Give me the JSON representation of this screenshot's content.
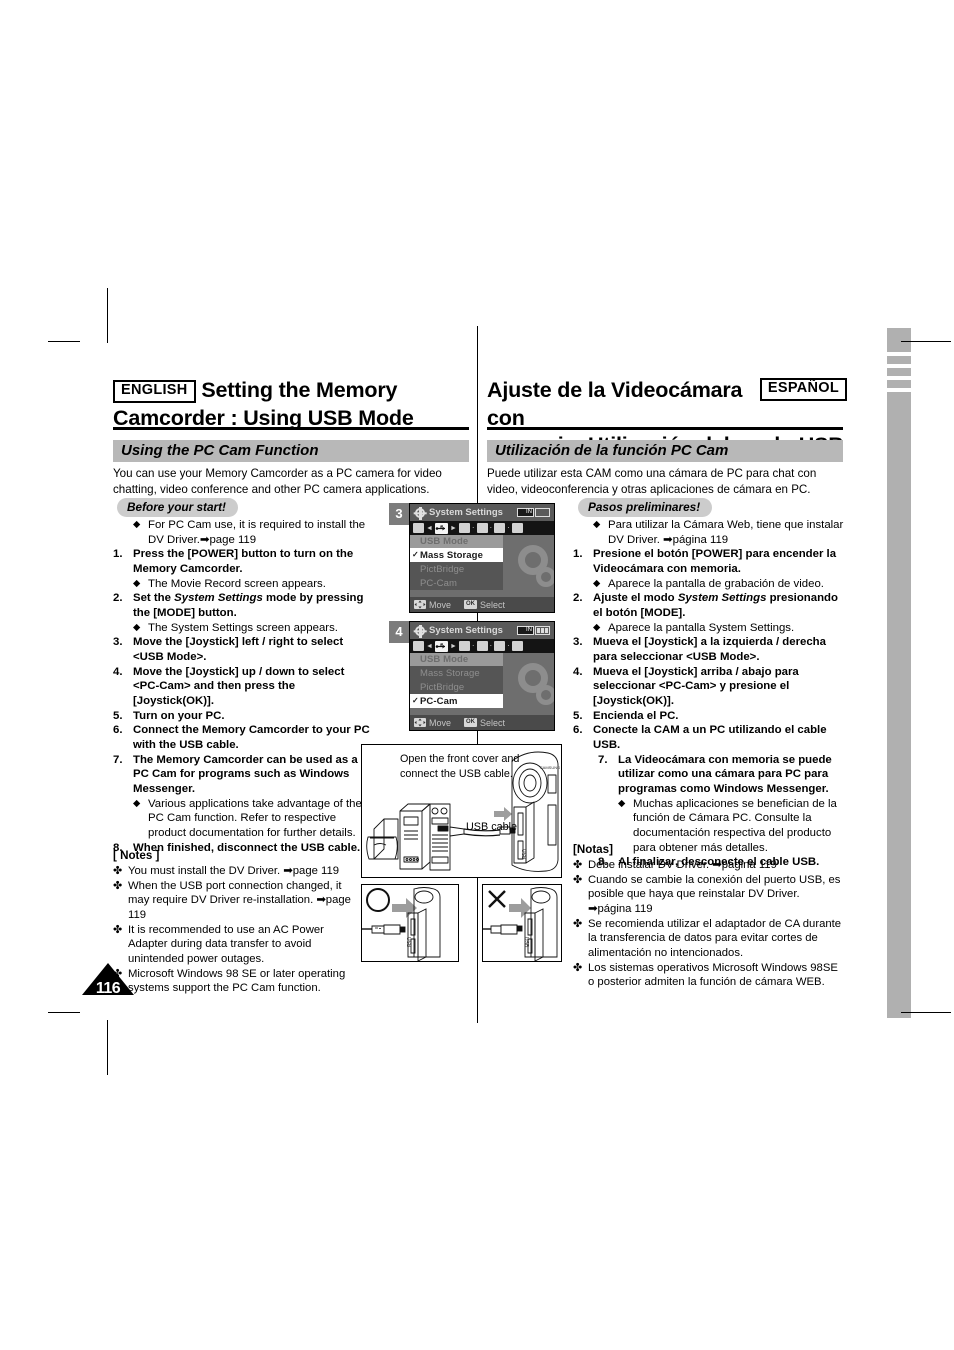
{
  "page": {
    "number": "116",
    "language_badges": {
      "english": "ENGLISH",
      "spanish": "ESPAÑOL"
    }
  },
  "english": {
    "title": "Setting the Memory Camcorder : Using USB Mode",
    "title_line1": "Setting the Memory",
    "title_line2": "Camcorder : Using USB Mode",
    "section_header": "Using the PC Cam Function",
    "intro": "You can use your Memory Camcorder as a PC camera for video chatting, video conference and other PC camera applications.",
    "pill": "Before your start!",
    "pre_bullet": "For PC Cam use,  it is required to install the DV Driver.➡page 119",
    "steps": [
      {
        "num": "1.",
        "text": "Press the [POWER] button to turn on the Memory Camcorder.",
        "subs": [
          "The Movie Record screen appears."
        ]
      },
      {
        "num": "2.",
        "text_pre": "Set the ",
        "text_italic": "System Settings",
        "text_post": " mode by pressing the [MODE] button.",
        "subs": [
          "The System Settings screen appears."
        ]
      },
      {
        "num": "3.",
        "text": "Move the [Joystick] left / right to select <USB Mode>.",
        "subs": []
      },
      {
        "num": "4.",
        "text": "Move the [Joystick] up / down to select <PC-Cam> and then press the [Joystick(OK)].",
        "subs": []
      },
      {
        "num": "5.",
        "text": "Turn on your PC.",
        "subs": []
      },
      {
        "num": "6.",
        "text": "Connect the Memory Camcorder to your PC with the USB cable.",
        "subs": []
      },
      {
        "num": "7.",
        "text": "The Memory Camcorder can be used as a PC Cam for programs such as Windows Messenger.",
        "subs": [
          "Various applications take advantage of the PC Cam function. Refer to respective product documentation for further details."
        ]
      },
      {
        "num": "8.",
        "text": "When finished, disconnect the USB cable.",
        "subs": []
      }
    ],
    "notes_title": "[ Notes ]",
    "notes": [
      "You must install the DV Driver. ➡page 119",
      "When the USB port connection changed, it may require DV Driver re-installation. ➡page 119",
      "It is recommended to use an AC Power Adapter during data transfer to avoid unintended power outages.",
      "Microsoft Windows 98 SE or later operating systems support the PC Cam function."
    ]
  },
  "spanish": {
    "title_line1": "Ajuste de la Videocámara con",
    "title_line2": "memoria: Utilización del modo USB",
    "section_header": "Utilización de la función PC Cam",
    "intro": "Puede utilizar esta CAM como una cámara de PC para chat con video, videoconferencia y otras aplicaciones de cámara en PC.",
    "pill": "Pasos preliminares!",
    "pre_bullet": "Para utilizar la Cámara Web, tiene que instalar DV Driver. ➡página 119",
    "steps": [
      {
        "num": "1.",
        "text": "Presione el botón [POWER] para encender la Videocámara con memoria.",
        "subs": [
          "Aparece la pantalla de grabación de video."
        ]
      },
      {
        "num": "2.",
        "text_pre": "Ajuste el modo ",
        "text_italic": "System Settings",
        "text_post": " presionando el botón [MODE].",
        "subs": [
          "Aparece la pantalla System Settings."
        ]
      },
      {
        "num": "3.",
        "text": "Mueva el [Joystick] a la izquierda / derecha para seleccionar <USB Mode>.",
        "subs": []
      },
      {
        "num": "4.",
        "text": "Mueva el [Joystick] arriba / abajo para seleccionar <PC-Cam> y presione el [Joystick(OK)].",
        "subs": []
      },
      {
        "num": "5.",
        "text": "Encienda el PC.",
        "subs": []
      },
      {
        "num": "6.",
        "text": "Conecte la CAM a un PC utilizando el cable USB.",
        "subs": []
      },
      {
        "num": "7.",
        "text": "La Videocámara con memoria se puede utilizar como una cámara para PC para programas como Windows Messenger.",
        "subs": [
          "Muchas aplicaciones se benefician de la función de Cámara PC. Consulte la documentación respectiva del producto para obtener más detalles."
        ]
      },
      {
        "num": "8.",
        "text": "Al finalizar, desconecte el cable USB.",
        "subs": []
      }
    ],
    "notes_title": "[Notas]",
    "notes": [
      "Debe instalar DV Driver. ➡página 119",
      "Cuando se cambie la conexión del puerto USB, es posible que haya que reinstalar DV Driver. ➡página 119",
      "Se recomienda utilizar el adaptador de CA durante la transferencia de datos para evitar cortes de alimentación no intencionados.",
      "Los sistemas operativos Microsoft Windows 98SE o posterior admiten la función de cámara WEB."
    ]
  },
  "lcd_screens": [
    {
      "step_tag": "3",
      "title": "System Settings",
      "menu_header": "USB Mode",
      "items": [
        "Mass Storage",
        "PictBridge",
        "PC-Cam"
      ],
      "selected": "Mass Storage",
      "footer_move": "Move",
      "footer_select": "Select",
      "footer_ok": "OK",
      "battery_label": "IN"
    },
    {
      "step_tag": "4",
      "title": "System Settings",
      "menu_header": "USB Mode",
      "items": [
        "Mass Storage",
        "PictBridge",
        "PC-Cam"
      ],
      "selected": "PC-Cam",
      "footer_move": "Move",
      "footer_select": "Select",
      "footer_ok": "OK",
      "battery_label": "IN"
    }
  ],
  "illustrations": {
    "main_caption_line1": "Open the front cover and",
    "main_caption_line2": "connect the USB cable.",
    "usb_cable_label": "USB cable",
    "port_label": "USB",
    "brand_label": "SAMSUNG",
    "ok_mark": "O",
    "ng_mark": "X"
  },
  "colors": {
    "section_bar": "#b8b8b8",
    "pill": "#cccccc",
    "margin_bar": "#b0b0b0",
    "lcd_background": "#6e6e6e",
    "lcd_menu": "#555555",
    "accent_black": "#000000"
  }
}
